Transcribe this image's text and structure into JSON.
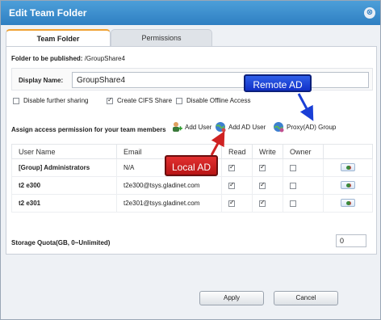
{
  "window": {
    "title": "Edit Team Folder",
    "close_glyph": "⊗"
  },
  "tabs": [
    {
      "label": "Team Folder",
      "active": true
    },
    {
      "label": "Permissions",
      "active": false
    }
  ],
  "folder": {
    "label": "Folder to be published:",
    "value": "/GroupShare4"
  },
  "display_name": {
    "label": "Display Name:",
    "value": "GroupShare4"
  },
  "options": [
    {
      "label": "Disable further sharing",
      "checked": false
    },
    {
      "label": "Create CIFS Share",
      "checked": true
    },
    {
      "label": "Disable Offline Access",
      "checked": false
    }
  ],
  "assign": {
    "label": "Assign access permission for your team members",
    "add_user": "Add User",
    "add_ad_user": "Add AD User",
    "proxy_ad_group": "Proxy(AD) Group"
  },
  "table": {
    "headers": [
      "User Name",
      "Email",
      "Read",
      "Write",
      "Owner",
      ""
    ],
    "rows": [
      {
        "name": "[Group] Administrators",
        "email": "N/A",
        "read": true,
        "write": true,
        "owner": false
      },
      {
        "name": "t2 e300",
        "email": "t2e300@tsys.gladinet.com",
        "read": true,
        "write": true,
        "owner": false
      },
      {
        "name": "t2 e301",
        "email": "t2e301@tsys.gladinet.com",
        "read": true,
        "write": true,
        "owner": false
      }
    ]
  },
  "storage": {
    "label": "Storage Quota(GB, 0~Unlimited)",
    "value": "0"
  },
  "buttons": {
    "apply": "Apply",
    "cancel": "Cancel"
  },
  "annotations": {
    "remote": "Remote AD",
    "local": "Local AD"
  },
  "colors": {
    "title_bar": "#3a8bcb",
    "remote_callout": "#1a3fd6",
    "local_callout": "#cf2222"
  }
}
